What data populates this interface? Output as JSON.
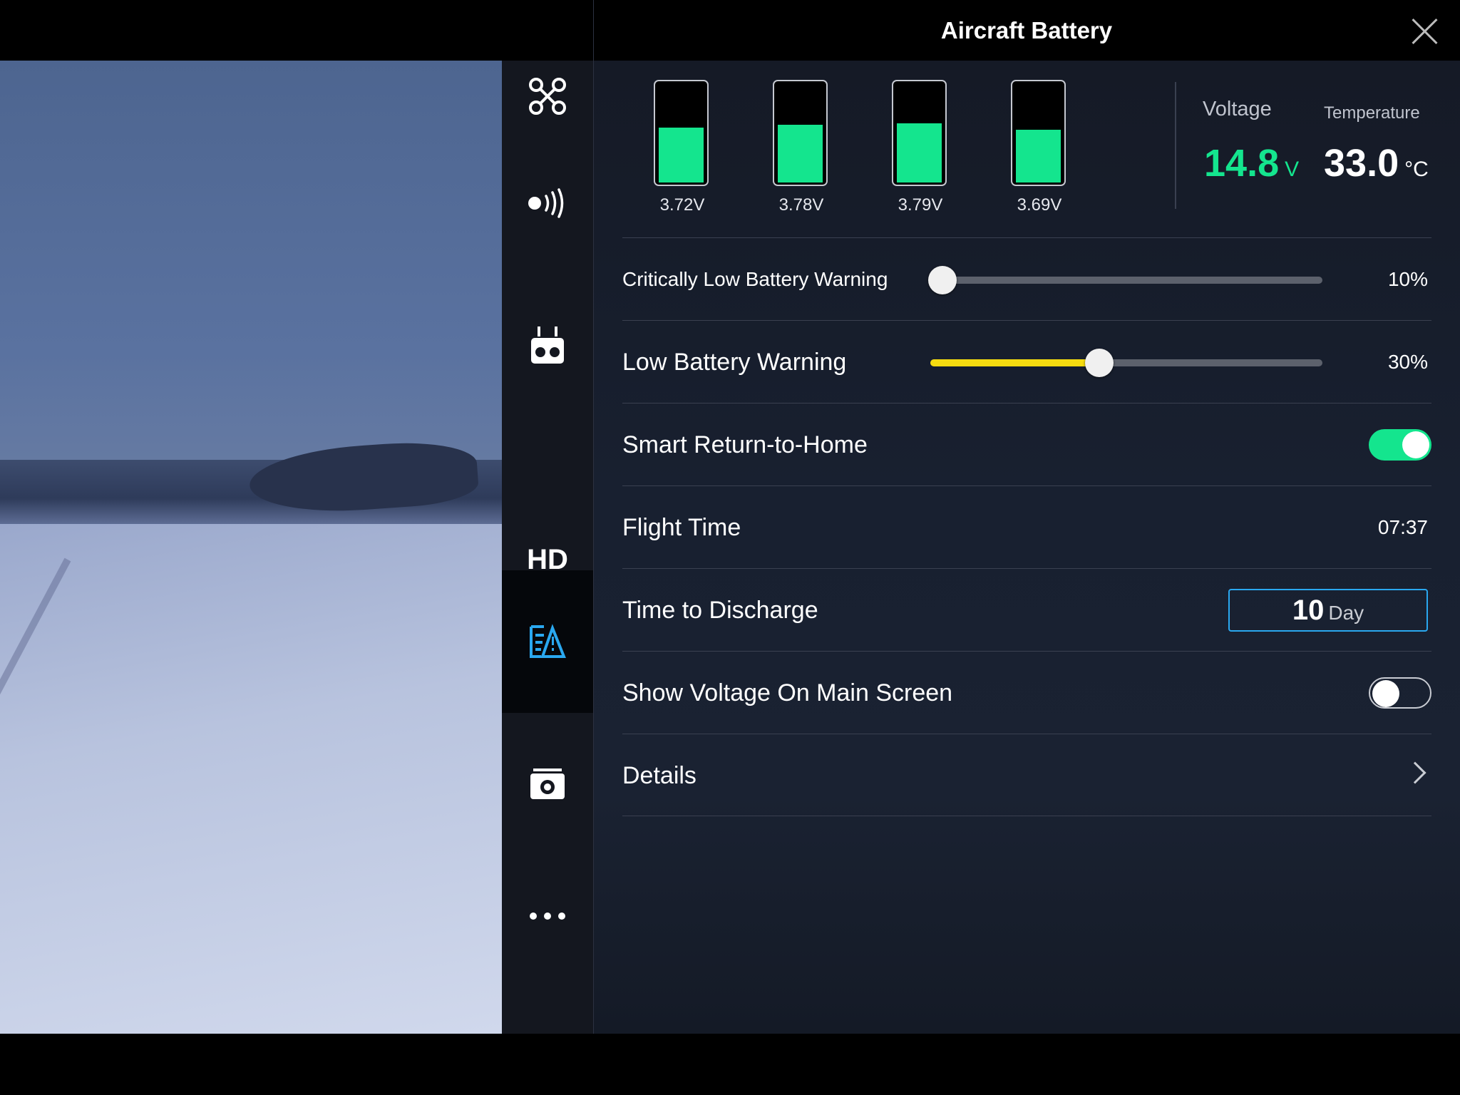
{
  "header": {
    "title": "Aircraft Battery"
  },
  "sidebar": {
    "items": [
      {
        "icon": "aircraft-icon"
      },
      {
        "icon": "signal-icon"
      },
      {
        "icon": "remote-controller-icon"
      },
      {
        "icon": "hd-icon",
        "label": "HD"
      },
      {
        "icon": "battery-icon",
        "active": true
      },
      {
        "icon": "camera-icon"
      },
      {
        "icon": "more-icon"
      }
    ]
  },
  "battery": {
    "cells": [
      {
        "voltage": "3.72V",
        "level": 0.53
      },
      {
        "voltage": "3.78V",
        "level": 0.56
      },
      {
        "voltage": "3.79V",
        "level": 0.57
      },
      {
        "voltage": "3.69V",
        "level": 0.51
      }
    ],
    "voltage": {
      "label": "Voltage",
      "value": "14.8",
      "unit": "V"
    },
    "temperature": {
      "label": "Temperature",
      "value": "33.0",
      "unit": "°C"
    }
  },
  "settings": {
    "critical_low": {
      "label": "Critically Low Battery Warning",
      "value": "10%",
      "level": 0.03
    },
    "low": {
      "label": "Low Battery Warning",
      "value": "30%",
      "level": 0.43
    },
    "smart_rth": {
      "label": "Smart Return-to-Home",
      "enabled": true
    },
    "flight_time": {
      "label": "Flight Time",
      "value": "07:37"
    },
    "discharge": {
      "label": "Time to Discharge",
      "value": "10",
      "unit": "Day"
    },
    "show_voltage": {
      "label": "Show Voltage On Main Screen",
      "enabled": false
    },
    "details": {
      "label": "Details"
    }
  },
  "colors": {
    "accent_green": "#14e58e",
    "slider_yellow": "#f6dc10",
    "input_blue": "#2aa8f0"
  }
}
